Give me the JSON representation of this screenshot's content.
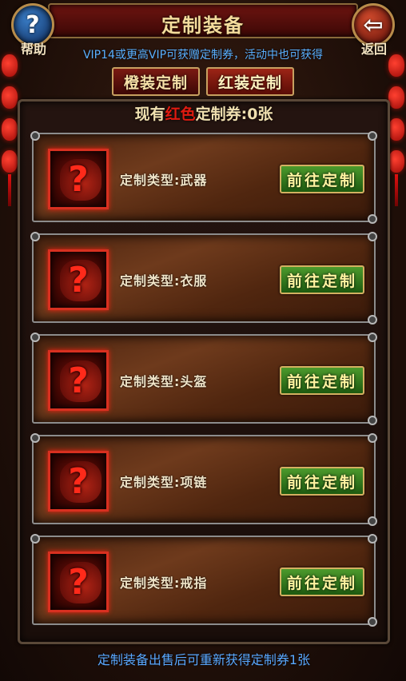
{
  "header": {
    "title": "定制装备",
    "help_label": "帮助",
    "back_label": "返回",
    "help_icon": "?",
    "back_icon": "⇦"
  },
  "vip_note": "VIP14或更高VIP可获赠定制券，活动中也可获得",
  "tabs": [
    {
      "label": "橙装定制"
    },
    {
      "label": "红装定制"
    }
  ],
  "coupon": {
    "prefix": "现有",
    "highlight": "红色",
    "suffix": "定制券:0张"
  },
  "cards": [
    {
      "label": "定制类型:武器",
      "button": "前往定制",
      "icon": "weapon-icon"
    },
    {
      "label": "定制类型:衣服",
      "button": "前往定制",
      "icon": "armor-icon"
    },
    {
      "label": "定制类型:头盔",
      "button": "前往定制",
      "icon": "helmet-icon"
    },
    {
      "label": "定制类型:项链",
      "button": "前往定制",
      "icon": "necklace-icon"
    },
    {
      "label": "定制类型:戒指",
      "button": "前往定制",
      "icon": "ring-icon"
    }
  ],
  "footer_note": "定制装备出售后可重新获得定制券1张",
  "colors": {
    "accent_red": "#e01a10",
    "note_blue": "#5ab0ff",
    "button_green": "#4c9a2c"
  }
}
